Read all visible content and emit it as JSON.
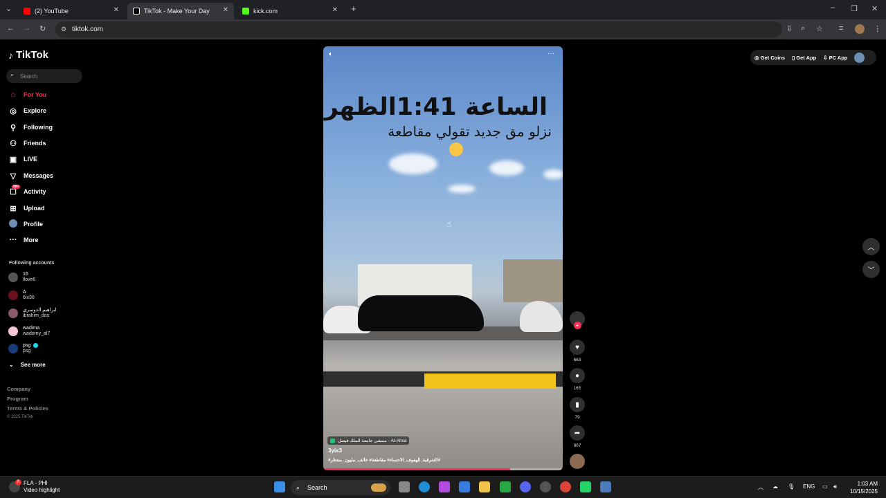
{
  "browser": {
    "tabs": [
      {
        "label": "(2) YouTube",
        "favicon_color": "#ff0000"
      },
      {
        "label": "TikTok - Make Your Day",
        "favicon_color": "#000000"
      },
      {
        "label": "kick.com",
        "favicon_color": "#53fc18"
      }
    ],
    "new_tab_glyph": "+",
    "url": "tiktok.com"
  },
  "sidebar": {
    "logo": "TikTok",
    "search_placeholder": "Search",
    "nav": [
      {
        "label": "For You",
        "icon": "home-icon"
      },
      {
        "label": "Explore",
        "icon": "compass-icon"
      },
      {
        "label": "Following",
        "icon": "following-icon"
      },
      {
        "label": "Friends",
        "icon": "friends-icon"
      },
      {
        "label": "LIVE",
        "icon": "live-icon"
      },
      {
        "label": "Messages",
        "icon": "messages-icon"
      },
      {
        "label": "Activity",
        "icon": "activity-icon",
        "badge": "99+"
      },
      {
        "label": "Upload",
        "icon": "upload-icon"
      },
      {
        "label": "Profile",
        "icon": "profile-icon"
      },
      {
        "label": "More",
        "icon": "more-icon"
      }
    ],
    "following_title": "Following accounts",
    "accounts": [
      {
        "name": "16",
        "handle": "llove6"
      },
      {
        "name": "A",
        "handle": "6ix30"
      },
      {
        "name": "ابراهيم الدوسري",
        "handle": "ibrahim_dos"
      },
      {
        "name": "wadima",
        "handle": "wadomy_al7"
      },
      {
        "name": "psg",
        "handle": "psg"
      }
    ],
    "see_more": "See more",
    "footer": [
      "Company",
      "Program",
      "Terms & Policies"
    ],
    "copyright": "© 2025 TikTok"
  },
  "video": {
    "overlay_line1": "الساعة 1:41الظهر",
    "overlay_line2": "نزلو مق جديد تقولي مقاطعة",
    "location": "ممشى جامعة الملك فيصل - Al-Ahsa",
    "author": "3yix3",
    "hashtags": "#الشرقية_الهفوف_الاحساء# مقاطعة# خالف_مليون_منتظر#",
    "progress": 0.78
  },
  "actions": {
    "likes": "663",
    "comments": "165",
    "saves": "79",
    "shares": "907"
  },
  "topbar": {
    "get_coins": "Get Coins",
    "get_app": "Get App",
    "pc_app": "PC App"
  },
  "taskbar": {
    "notification_title": "FLA - PHI",
    "notification_sub": "Video highlight",
    "notification_badge": "6",
    "search": "Search",
    "language": "ENG",
    "time": "1:03 AM",
    "date": "10/15/2025"
  }
}
